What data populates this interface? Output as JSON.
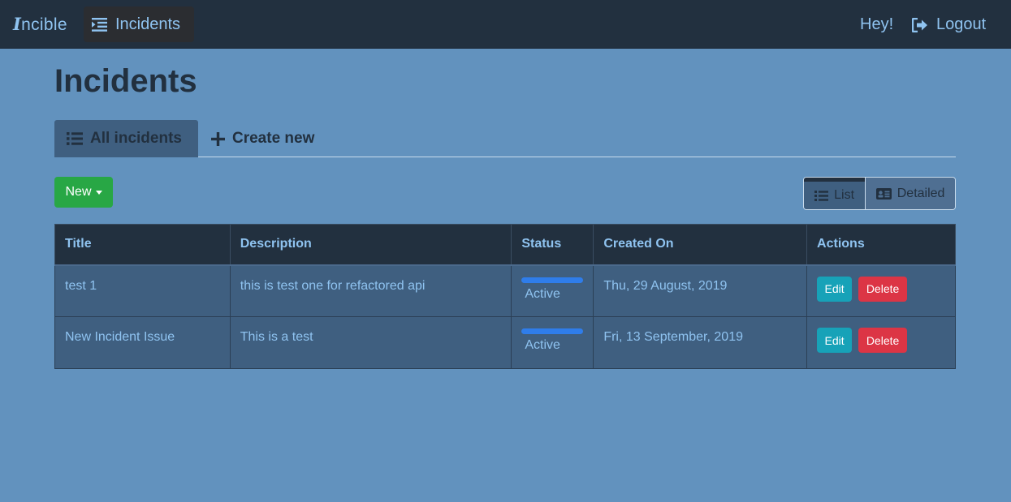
{
  "nav": {
    "brand_letter": "I",
    "brand_rest": "ncible",
    "incidents_label": "Incidents",
    "greeting": "Hey!",
    "logout_label": "Logout"
  },
  "page": {
    "title": "Incidents"
  },
  "tabs": [
    {
      "label": "All incidents",
      "active": true,
      "icon": "list-icon"
    },
    {
      "label": "Create new",
      "active": false,
      "icon": "plus-icon"
    }
  ],
  "toolbar": {
    "new_label": "New",
    "view_list_label": "List",
    "view_detailed_label": "Detailed",
    "selected_view": "List"
  },
  "table": {
    "headers": [
      "Title",
      "Description",
      "Status",
      "Created On",
      "Actions"
    ],
    "rows": [
      {
        "title": "test 1",
        "description": "this is test one for refactored api",
        "status": "Active",
        "created_on": "Thu, 29 August, 2019"
      },
      {
        "title": "New Incident Issue",
        "description": "This is a test",
        "status": "Active",
        "created_on": "Fri, 13 September, 2019"
      }
    ],
    "edit_label": "Edit",
    "delete_label": "Delete"
  },
  "colors": {
    "background": "#6292be",
    "navbar": "#22303f",
    "accent_text": "#8fc3f0",
    "new_button": "#28a745",
    "edit_button": "#17a2b8",
    "delete_button": "#dc3545",
    "status_bar": "#2f7dea"
  }
}
